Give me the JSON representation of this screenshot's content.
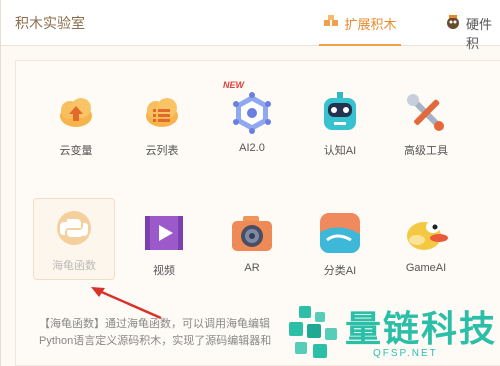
{
  "window": {
    "title": "积木实验室"
  },
  "tabs": [
    {
      "label": "扩展积木",
      "active": true
    },
    {
      "label": "硬件积"
    }
  ],
  "row1": [
    {
      "label": "云变量",
      "icon": "cloud-upload-icon"
    },
    {
      "label": "云列表",
      "icon": "cloud-list-icon"
    },
    {
      "label": "AI2.0",
      "icon": "hexagon-network-icon",
      "badge": "NEW"
    },
    {
      "label": "认知AI",
      "icon": "robot-icon"
    },
    {
      "label": "高级工具",
      "icon": "tools-icon"
    }
  ],
  "row2": [
    {
      "label": "海龟函数",
      "icon": "python-icon",
      "selected": true
    },
    {
      "label": "视频",
      "icon": "video-icon"
    },
    {
      "label": "AR",
      "icon": "camera-icon"
    },
    {
      "label": "分类AI",
      "icon": "classify-icon"
    },
    {
      "label": "GameAI",
      "icon": "bird-icon"
    }
  ],
  "description": {
    "line1": "【海龟函数】通过海龟函数，可以调用海龟编辑",
    "line2": "Python语言定义源码积木，实现了源码编辑器和"
  },
  "watermark": {
    "text": "量链科技",
    "sub": "QFSP.NET"
  },
  "colors": {
    "accent": "#e98a2b",
    "watermark": "#2cbfa8"
  }
}
